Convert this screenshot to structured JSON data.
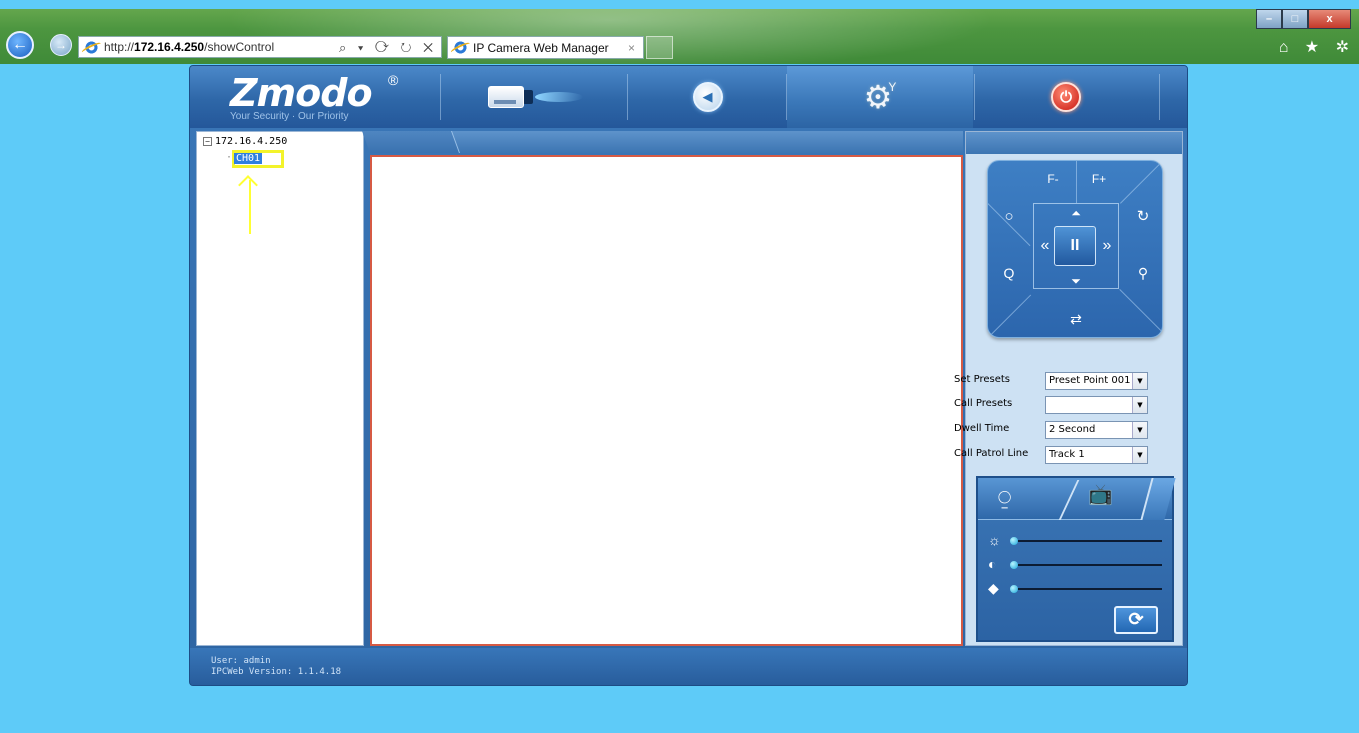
{
  "browser": {
    "address_prefix": "http://",
    "address_host": "172.16.4.250",
    "address_path": "/showControl",
    "address_tools": "⌕ ▾ ⟳ ↻ ✕",
    "tab_title": "IP Camera Web Manager",
    "tab_close": "×",
    "back_glyph": "←",
    "forward_glyph": "→",
    "window_controls": {
      "minimize": "–",
      "maximize": "□",
      "close": "x"
    },
    "toolbar_icons": "⌂ ★ ✲"
  },
  "app": {
    "logo_text": "Zmodo",
    "logo_registered": "®",
    "logo_tagline": "Your Security · Our Priority",
    "nav": [
      {
        "icon": "live-view-camera-icon",
        "active": false
      },
      {
        "icon": "playback-icon",
        "active": false
      },
      {
        "icon": "settings-gear-icon",
        "active": true
      },
      {
        "icon": "power-logout-icon",
        "active": false
      }
    ],
    "gear_glyph": "⚙",
    "gear_sub_glyph": "Y",
    "back_glyph": "◀",
    "power_glyph": "⏻",
    "tree": {
      "root_toggle": "−",
      "root_label": "172.16.4.250",
      "child_connector": "···",
      "child_label": "CH01"
    },
    "ptz": {
      "focus_minus": "F-",
      "focus_plus": "F+",
      "iris_close": "○",
      "iris_open": "↻",
      "zoom_out": "Q",
      "zoom_in": "⚲",
      "up": "⏶",
      "down": "⏷",
      "left": "«",
      "right": "»",
      "pause": "II",
      "auto_scan": "⇄"
    },
    "presets": [
      {
        "label": "Set Presets",
        "value": "Preset Point 001"
      },
      {
        "label": "Call Presets",
        "value": ""
      },
      {
        "label": "Dwell Time",
        "value": "2 Second"
      },
      {
        "label": "Call Patrol Line",
        "value": "Track 1"
      }
    ],
    "dropdown_glyph": "▼",
    "image_tabs": {
      "camera_glyph": "⍜",
      "tv_glyph": "📺"
    },
    "sliders": [
      {
        "name": "brightness",
        "icon": "☼",
        "value": 0.0
      },
      {
        "name": "contrast",
        "icon": "◐",
        "value": 0.0
      },
      {
        "name": "saturation",
        "icon": "◆",
        "value": 0.0
      }
    ],
    "refresh_glyph": "⟳",
    "status": {
      "user": "User: admin",
      "version": "IPCWeb Version: 1.1.4.18"
    }
  }
}
